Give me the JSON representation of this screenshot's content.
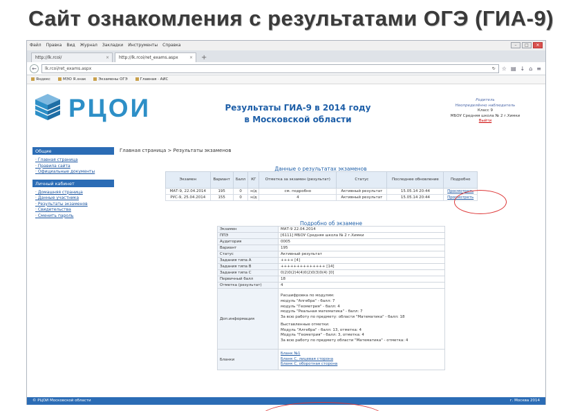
{
  "slide": {
    "title": "Сайт ознакомления с результатами ОГЭ (ГИА-9)"
  },
  "browser": {
    "menu": [
      "Файл",
      "Правка",
      "Вид",
      "Журнал",
      "Закладки",
      "Инструменты",
      "Справка"
    ],
    "tabs": [
      {
        "label": "http://lk.rcoi/"
      },
      {
        "label": "http://lk.rcoi/ret_exams.aspx"
      }
    ],
    "url": "lk.rcoi/ret_exams.aspx",
    "bookmarks": [
      "Яндекс",
      "МЭО Я.знак",
      "Экзамены ОГЭ",
      "Главная · АИС"
    ]
  },
  "site": {
    "logo": "РЦОИ",
    "heading_line1": "Результаты ГИА-9 в 2014 году",
    "heading_line2": "в Московской области",
    "user": {
      "role": "Родитель",
      "name": "Неопределённо наблюдатель",
      "class": "Класс 9",
      "school": "МБОУ Средняя школа № 2 г.Химки",
      "logout": "Выйти"
    },
    "sidebar": {
      "general_title": "Общие",
      "general_items": [
        "Главная страница",
        "Правила сайта",
        "Официальные документы"
      ],
      "cabinet_title": "Личный кабинет",
      "cabinet_items": [
        "Домашняя страница",
        "Данные участника",
        "Результаты экзаменов",
        "Свидетельства",
        "Сменить пароль"
      ]
    },
    "breadcrumb": "Главная страница > Результаты экзаменов",
    "results_title": "Данные о результатах экзаменов",
    "results_headers": [
      "Экзамен",
      "Вариант",
      "Балл",
      "КГ",
      "Отметка за экзамен (результат)",
      "Статус",
      "Последнее обновление",
      "Подробно"
    ],
    "results_rows": [
      [
        "МАТ-9, 22.04.2014",
        "195",
        "0",
        "н/д",
        "см. подробно",
        "Активный результат",
        "15.05.14 20:44",
        "Просмотреть"
      ],
      [
        "РУС-9, 25.04.2014",
        "155",
        "0",
        "н/д",
        "4",
        "Активный результат",
        "15.05.14 20:44",
        "Просмотреть"
      ]
    ],
    "detail_title": "Подробно об экзамене",
    "detail_rows": [
      [
        "Экзамен",
        "МАТ-9 22.04.2014"
      ],
      [
        "ППЭ",
        "[6111] МБОУ Средняя школа № 2 г.Химки"
      ],
      [
        "Аудитория",
        "0005"
      ],
      [
        "Вариант",
        "195"
      ],
      [
        "Статус",
        "Активный результат"
      ],
      [
        "Задания типа А",
        "++++ [4]"
      ],
      [
        "Задания типа В",
        "++++++++++++++ [14]"
      ],
      [
        "Задания типа С",
        "0(2)0(2)4(4)0(2)0(3)0(4) [0]"
      ],
      [
        "Первичный балл",
        "18"
      ],
      [
        "Отметка (результат)",
        "4"
      ]
    ],
    "extra_label": "Доп.информация",
    "extra_lines_1": [
      "Расшифровка по модулям:",
      "модуль \"Алгебра\" - балл: 7",
      "модуль \"Геометрия\" - балл: 4",
      "модуль \"Реальная математика\" - балл: 7",
      "За всю работу по предмету: области \"Математика\" - балл: 18"
    ],
    "extra_lines_2": [
      "Выставленные отметки:",
      "Модуль \"Алгебра\" - балл: 13, отметка: 4",
      "Модуль \"Геометрия\" - балл: 3, отметка: 4",
      "За всю работу по предмету области \"Математика\" - отметка: 4"
    ],
    "blanks_label": "Бланки",
    "blanks": [
      "Бланк №1",
      "Бланк С, лицевая сторона",
      "Бланк С, оборотная сторона"
    ],
    "footer_left": "© РЦОИ Московской области",
    "footer_right": "г. Москва 2014"
  }
}
